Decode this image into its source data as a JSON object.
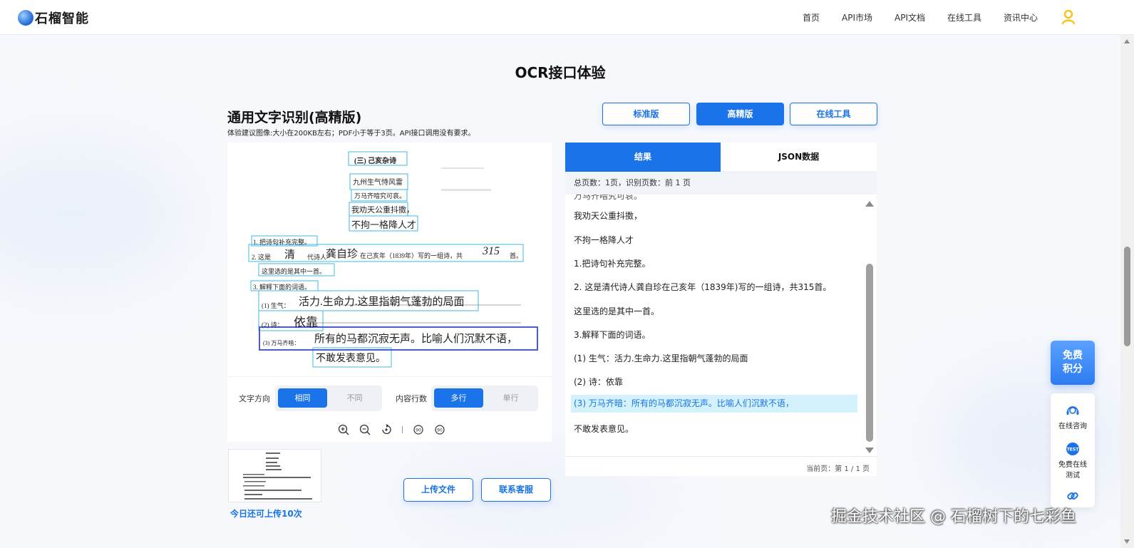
{
  "header": {
    "logo_text": "石榴智能",
    "nav": [
      "首页",
      "API市场",
      "API文档",
      "在线工具",
      "资讯中心"
    ]
  },
  "page": {
    "title": "OCR接口体验",
    "section_title": "通用文字识别(高精版)",
    "section_subtitle": "体验建议图像:大小在200KB左右；PDF小于等于3页。API接口调用没有要求。"
  },
  "modes": {
    "standard": "标准版",
    "precise": "高精版",
    "online_tool": "在线工具"
  },
  "document": {
    "lines": [
      "(三)  己亥杂诗",
      "九州生气恃风雷",
      "万马齐喑究可哀。",
      "我劝天公重抖擞，",
      "不拘一格降人才",
      "1. 把诗句补充完整。",
      "2. 这是",
      "清",
      "代诗人",
      "龚自珍",
      "在己亥年（1839年）写的一组诗，共",
      "315",
      "首。",
      "这里选的是其中一首。",
      "3. 解释下面的词语。",
      "(1) 生气：",
      "活力.生命力.这里指朝气蓬勃的局面",
      "(2) 诗：",
      "依靠",
      "(3) 万马齐喑：",
      "所有的马都沉寂无声。比喻人们沉默不语，",
      "不敢发表意见。"
    ]
  },
  "controls": {
    "direction_label": "文字方向",
    "direction_on": "相同",
    "direction_off": "不同",
    "lines_label": "内容行数",
    "lines_on": "多行",
    "lines_off": "单行"
  },
  "upload": {
    "remaining": "今日还可上传10次",
    "upload_button": "上传文件",
    "contact_button": "联系客服"
  },
  "results": {
    "tab_result": "结果",
    "tab_json": "JSON数据",
    "meta": "总页数：1页，识别页数：前 1 页",
    "lines": [
      "我劝天公重抖擞，",
      "不拘一格降人才",
      "1.把诗句补充完整。",
      "2. 这是清代诗人龚自珍在己亥年（1839年)写的一组诗，共315首。",
      "这里选的是其中一首。",
      "3.解释下面的词语。",
      "(1) 生气：活力.生命力.这里指朝气蓬勃的局面",
      "(2) 诗：依靠",
      "(3) 万马齐暗：所有的马都沉寂无声。比喻人们沉默不语，",
      "不敢发表意见。"
    ],
    "highlighted_index": 8,
    "page_indicator": "当前页：第 1 / 1 页"
  },
  "float": {
    "points_line1": "免费",
    "points_line2": "积分",
    "consult": "在线咨询",
    "test_line1": "免费在线",
    "test_line2": "测试",
    "test_badge": "TEST"
  },
  "watermark": "掘金技术社区 @ 石榴树下的七彩鱼",
  "colors": {
    "accent": "#1a73e8",
    "highlight_bg": "#d4f2fb",
    "user_icon": "#f5c518"
  }
}
